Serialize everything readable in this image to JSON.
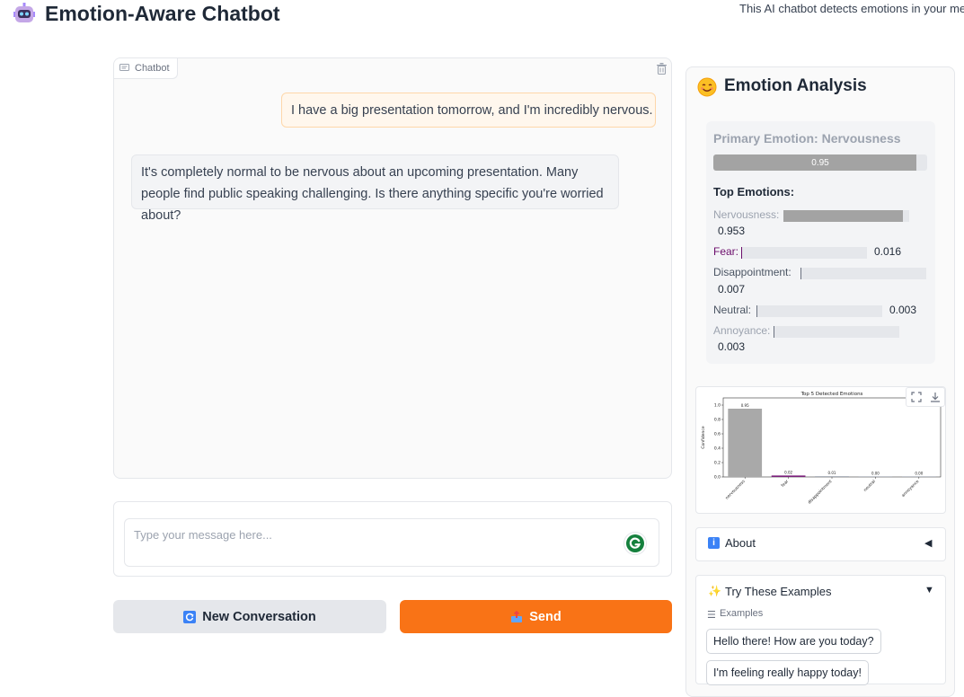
{
  "header": {
    "icon": "robot-icon",
    "title": "Emotion-Aware Chatbot",
    "subtitle": "This AI chatbot detects emotions in your mess"
  },
  "chatbot": {
    "tab_label": "Chatbot",
    "messages": [
      {
        "role": "user",
        "text": "I have a big presentation tomorrow, and I'm incredibly nervous."
      },
      {
        "role": "bot",
        "text": "It's completely normal to be nervous about an upcoming presentation. Many people find public speaking challenging. Is there anything specific you're worried about?"
      }
    ]
  },
  "input": {
    "placeholder": "Type your message here...",
    "value": ""
  },
  "buttons": {
    "new_conversation": "New Conversation",
    "send": "Send"
  },
  "emotion_panel": {
    "icon": "smiling-face-icon",
    "title": "Emotion Analysis",
    "primary_label": "Primary Emotion: Nervousness",
    "primary_value": "0.95",
    "primary_fraction": 0.95,
    "top_title": "Top Emotions:",
    "emotions": [
      {
        "name": "Nervousness:",
        "value": "0.953",
        "fraction": 0.953,
        "color": "#9ca3af"
      },
      {
        "name": "Fear:",
        "value": "0.016",
        "fraction": 0.016,
        "color": "#6b0d6b"
      },
      {
        "name": "Disappointment:",
        "value": "0.007",
        "fraction": 0.007,
        "color": "#4b5563"
      },
      {
        "name": "Neutral:",
        "value": "0.003",
        "fraction": 0.003,
        "color": "#4b5563"
      },
      {
        "name": "Annoyance:",
        "value": "0.003",
        "fraction": 0.003,
        "color": "#9ca3af"
      }
    ]
  },
  "chart_data": {
    "type": "bar",
    "title": "Top 5 Detected Emotions",
    "xlabel": "",
    "ylabel": "Confidence",
    "categories": [
      "nervousness",
      "fear",
      "disappointment",
      "neutral",
      "annoyance"
    ],
    "values": [
      0.95,
      0.02,
      0.01,
      0.0,
      0.0
    ],
    "value_labels": [
      "0.95",
      "0.02",
      "0.01",
      "0.00",
      "0.00"
    ],
    "bar_colors": [
      "#a9a9a9",
      "#7b1f7b",
      "#9ca3af",
      "#9ca3af",
      "#9ca3af"
    ],
    "ylim": [
      0,
      1.1
    ],
    "yticks": [
      0.0,
      0.2,
      0.4,
      0.6,
      0.8,
      1.0
    ],
    "ytick_labels": [
      "0.0",
      "0.2",
      "0.4",
      "0.6",
      "0.8",
      "1.0"
    ]
  },
  "about": {
    "label": "About",
    "arrow": "◀"
  },
  "examples": {
    "label": "Try These Examples",
    "arrow": "▼",
    "sub_label": "Examples",
    "items": [
      "Hello there! How are you today?",
      "I'm feeling really happy today!"
    ]
  },
  "colors": {
    "accent": "#f97316",
    "user_bubble": "#fff7ed",
    "bot_bubble": "#f3f4f6"
  }
}
